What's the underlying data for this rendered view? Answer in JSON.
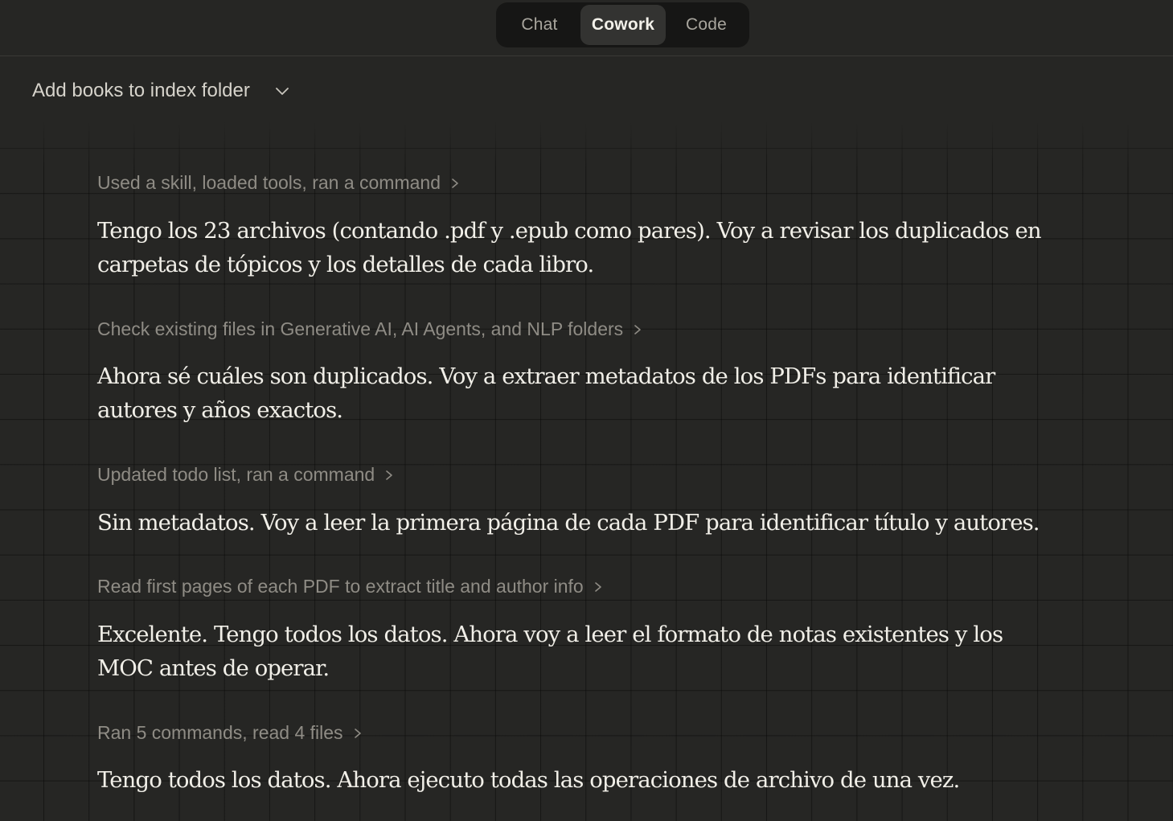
{
  "mode_switch": {
    "tabs": [
      {
        "label": "Chat",
        "active": false
      },
      {
        "label": "Cowork",
        "active": true
      },
      {
        "label": "Code",
        "active": false
      }
    ]
  },
  "header": {
    "title": "Add books to index folder"
  },
  "transcript": [
    {
      "step": "Used a skill, loaded tools, ran a command",
      "message": "Tengo los 23 archivos (contando .pdf y .epub como pares). Voy a revisar los duplicados en carpetas de tópicos y los detalles de cada libro."
    },
    {
      "step": "Check existing files in Generative AI, AI Agents, and NLP folders",
      "message": "Ahora sé cuáles son duplicados. Voy a extraer metadatos de los PDFs para identificar autores y años exactos."
    },
    {
      "step": "Updated todo list, ran a command",
      "message": "Sin metadatos. Voy a leer la primera página de cada PDF para identificar título y autores."
    },
    {
      "step": "Read first pages of each PDF to extract title and author info",
      "message": "Excelente. Tengo todos los datos. Ahora voy a leer el formato de notas existentes y los MOC antes de operar."
    },
    {
      "step": "Ran 5 commands, read 4 files",
      "message": "Tengo todos los datos. Ahora ejecuto todas las operaciones de archivo de una vez."
    }
  ],
  "icons": {
    "title_dropdown": "chevron-down-icon",
    "step_expand": "chevron-right-icon"
  },
  "colors": {
    "background": "#262624",
    "switch_background": "#161615",
    "active_tab": "#333331",
    "step_text": "#8f8c85",
    "message_text": "#f1efe8"
  }
}
